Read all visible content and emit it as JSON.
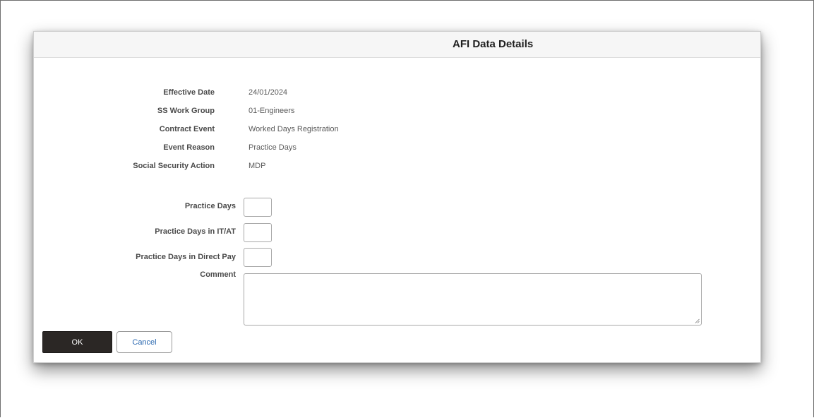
{
  "dialog": {
    "title": "AFI Data Details"
  },
  "details": [
    {
      "label": "Effective Date",
      "value": "24/01/2024"
    },
    {
      "label": "SS Work Group",
      "value": "01-Engineers"
    },
    {
      "label": "Contract Event",
      "value": "Worked Days Registration"
    },
    {
      "label": "Event Reason",
      "value": "Practice Days"
    },
    {
      "label": "Social Security Action",
      "value": "MDP"
    }
  ],
  "fields": {
    "practice_days": {
      "label": "Practice Days",
      "value": ""
    },
    "practice_days_itat": {
      "label": "Practice Days in IT/AT",
      "value": ""
    },
    "practice_days_direct_pay": {
      "label": "Practice Days in Direct Pay",
      "value": ""
    },
    "comment": {
      "label": "Comment",
      "value": ""
    }
  },
  "buttons": {
    "ok": "OK",
    "cancel": "Cancel"
  }
}
